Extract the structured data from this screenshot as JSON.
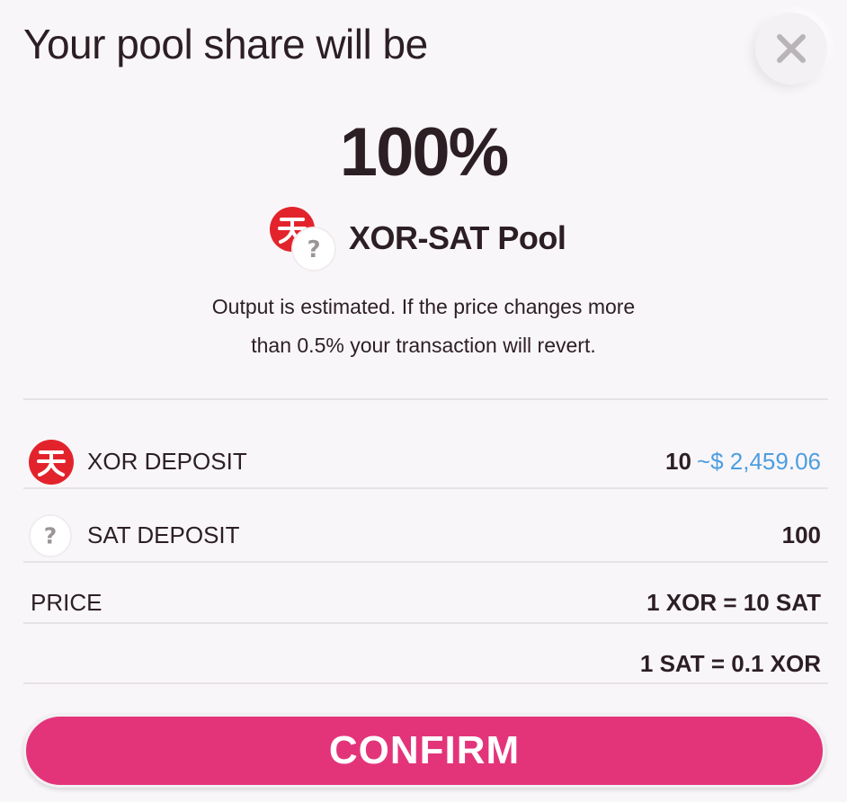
{
  "dialog": {
    "title": "Your pool share will be",
    "share_percent": "100%",
    "pool_name": "XOR-SAT Pool",
    "info_line_1": "Output is estimated. If the price changes more",
    "info_line_2": "than 0.5% your transaction will revert."
  },
  "details": {
    "xor_deposit": {
      "label": "XOR DEPOSIT",
      "amount": "10",
      "usd_value": "~$ 2,459.06",
      "icon": "xor-token-icon"
    },
    "sat_deposit": {
      "label": "SAT DEPOSIT",
      "amount": "100",
      "icon": "unknown-token-icon"
    },
    "price": {
      "label": "PRICE",
      "xor_to_sat": "1 XOR = 10 SAT",
      "sat_to_xor": "1 SAT = 0.1 XOR"
    }
  },
  "confirm_label": "CONFIRM",
  "colors": {
    "background": "#f9f6f9",
    "accent": "#e3347a",
    "xor_red": "#e3232c",
    "usd_blue": "#4c9ee0",
    "text": "#2c1f24"
  }
}
